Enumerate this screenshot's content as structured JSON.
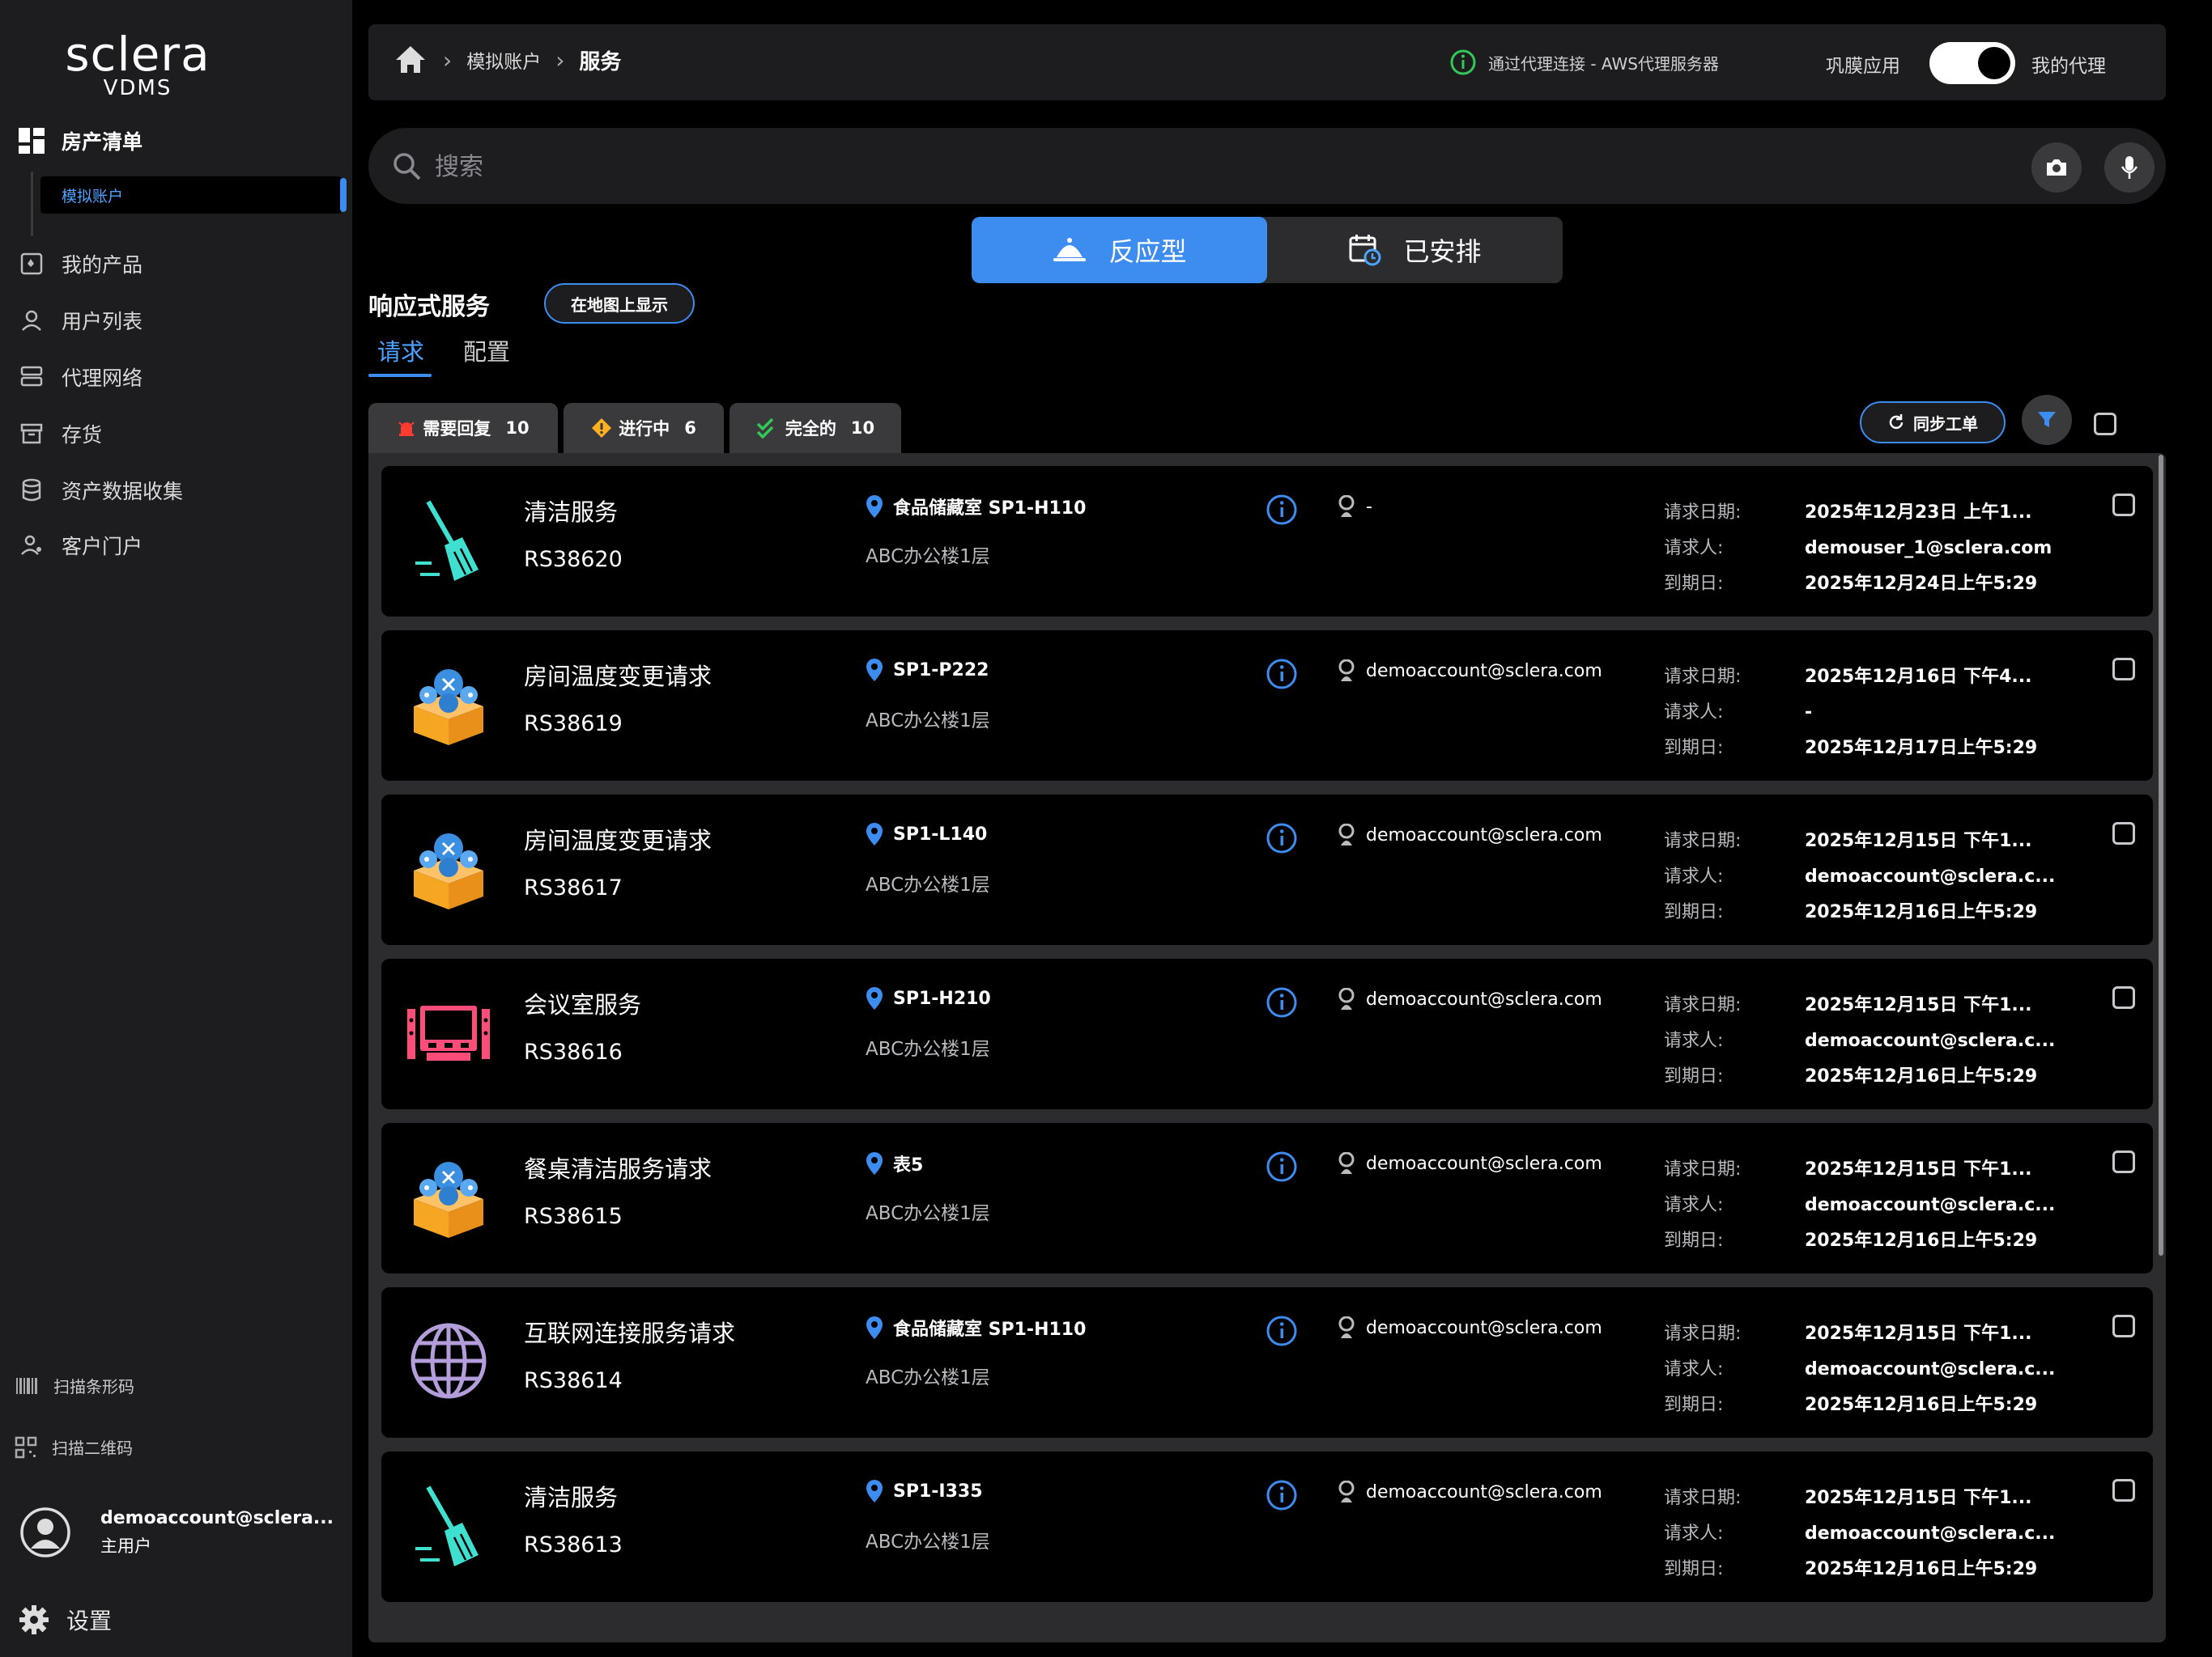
{
  "sidebar": {
    "brand": "sclera",
    "brand_sub": "VDMS",
    "top_item": "房产清单",
    "sub_item": "模拟账户",
    "items": [
      {
        "label": "我的产品",
        "icon": "product-icon"
      },
      {
        "label": "用户列表",
        "icon": "user-icon"
      },
      {
        "label": "代理网络",
        "icon": "network-icon"
      },
      {
        "label": "存货",
        "icon": "inventory-icon"
      },
      {
        "label": "资产数据收集",
        "icon": "database-icon"
      },
      {
        "label": "客户门户",
        "icon": "portal-icon"
      }
    ],
    "scan_barcode": "扫描条形码",
    "scan_qr": "扫描二维码",
    "user_email": "demoaccount@sclera...",
    "user_role": "主用户",
    "settings": "设置"
  },
  "header": {
    "crumb_1": "模拟账户",
    "crumb_2": "服务",
    "connection": "通过代理连接 - AWS代理服务器",
    "toggle_left": "巩膜应用",
    "toggle_right": "我的代理",
    "toggle_on": true
  },
  "search": {
    "placeholder": "搜索"
  },
  "segments": {
    "reactive": "反应型",
    "scheduled": "已安排"
  },
  "section": {
    "title": "响应式服务",
    "map_button": "在地图上显示",
    "tab_requests": "请求",
    "tab_config": "配置"
  },
  "status_tabs": [
    {
      "label": "需要回复",
      "count": "10",
      "color": "#ff3b30"
    },
    {
      "label": "进行中",
      "count": "6",
      "color": "#ffb020"
    },
    {
      "label": "完全的",
      "count": "10",
      "color": "#34c759"
    }
  ],
  "toolbar": {
    "sync_label": "同步工单"
  },
  "field_labels": {
    "requested": "请求日期:",
    "requester": "请求人:",
    "due": "到期日:"
  },
  "requests": [
    {
      "name": "清洁服务",
      "code": "RS38620",
      "room": "食品储藏室 SP1-H110",
      "building": "ABC办公楼1层",
      "account": "-",
      "requested": "2025年12月23日 上午1...",
      "requester": "demouser_1@sclera.com",
      "due": "2025年12月24日上午5:29",
      "icon": "broom-icon"
    },
    {
      "name": "房间温度变更请求",
      "code": "RS38619",
      "room": "SP1-P222",
      "building": "ABC办公楼1层",
      "account": "demoaccount@sclera.com",
      "requested": "2025年12月16日 下午4...",
      "requester": "-",
      "due": "2025年12月17日上午5:29",
      "icon": "service-box-icon"
    },
    {
      "name": "房间温度变更请求",
      "code": "RS38617",
      "room": "SP1-L140",
      "building": "ABC办公楼1层",
      "account": "demoaccount@sclera.com",
      "requested": "2025年12月15日 下午1...",
      "requester": "demoaccount@sclera.c...",
      "due": "2025年12月16日上午5:29",
      "icon": "service-box-icon"
    },
    {
      "name": "会议室服务",
      "code": "RS38616",
      "room": "SP1-H210",
      "building": "ABC办公楼1层",
      "account": "demoaccount@sclera.com",
      "requested": "2025年12月15日 下午1...",
      "requester": "demoaccount@sclera.c...",
      "due": "2025年12月16日上午5:29",
      "icon": "meeting-room-icon"
    },
    {
      "name": "餐桌清洁服务请求",
      "code": "RS38615",
      "room": "表5",
      "building": "ABC办公楼1层",
      "account": "demoaccount@sclera.com",
      "requested": "2025年12月15日 下午1...",
      "requester": "demoaccount@sclera.c...",
      "due": "2025年12月16日上午5:29",
      "icon": "service-box-icon"
    },
    {
      "name": "互联网连接服务请求",
      "code": "RS38614",
      "room": "食品储藏室 SP1-H110",
      "building": "ABC办公楼1层",
      "account": "demoaccount@sclera.com",
      "requested": "2025年12月15日 下午1...",
      "requester": "demoaccount@sclera.c...",
      "due": "2025年12月16日上午5:29",
      "icon": "globe-icon"
    },
    {
      "name": "清洁服务",
      "code": "RS38613",
      "room": "SP1-I335",
      "building": "ABC办公楼1层",
      "account": "demoaccount@sclera.com",
      "requested": "2025年12月15日 下午1...",
      "requester": "demoaccount@sclera.c...",
      "due": "2025年12月16日上午5:29",
      "icon": "broom-icon"
    }
  ],
  "colors": {
    "accent": "#3d8cf0",
    "panel": "#1d1d1f",
    "card": "#000000"
  }
}
